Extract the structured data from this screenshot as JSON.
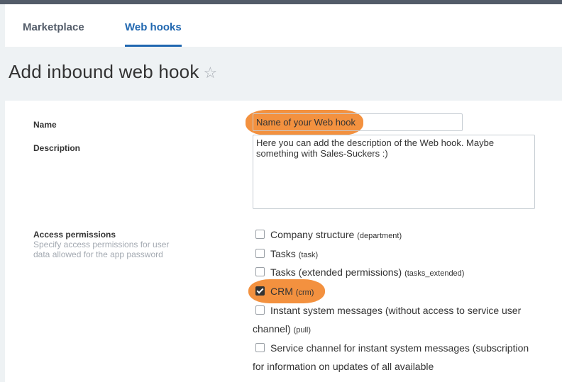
{
  "tabs": [
    {
      "label": "Marketplace",
      "active": false
    },
    {
      "label": "Web hooks",
      "active": true
    }
  ],
  "page": {
    "title": "Add inbound web hook",
    "star": "☆"
  },
  "form": {
    "name_label": "Name",
    "name_value": "Name of your Web hook",
    "description_label": "Description",
    "description_value": "Here you can add the description of the Web hook. Maybe something with Sales-Suckers :)",
    "access_label": "Access permissions",
    "access_hint": "Specify access permissions for user data allowed for the app password"
  },
  "permissions": [
    {
      "label": "Company structure",
      "code": "(department)",
      "checked": false
    },
    {
      "label": "Tasks",
      "code": "(task)",
      "checked": false
    },
    {
      "label": "Tasks (extended permissions)",
      "code": "(tasks_extended)",
      "checked": false
    },
    {
      "label": "CRM",
      "code": "(crm)",
      "checked": true
    },
    {
      "label": "Instant system messages (without access to service user channel)",
      "code": "(pull)",
      "checked": false
    },
    {
      "label": "Service channel for instant system messages (subscription for information on updates of all available",
      "code": "",
      "checked": false
    }
  ],
  "colors": {
    "accent": "#2067b0",
    "highlight": "#f2882f",
    "topbar": "#535c69"
  }
}
